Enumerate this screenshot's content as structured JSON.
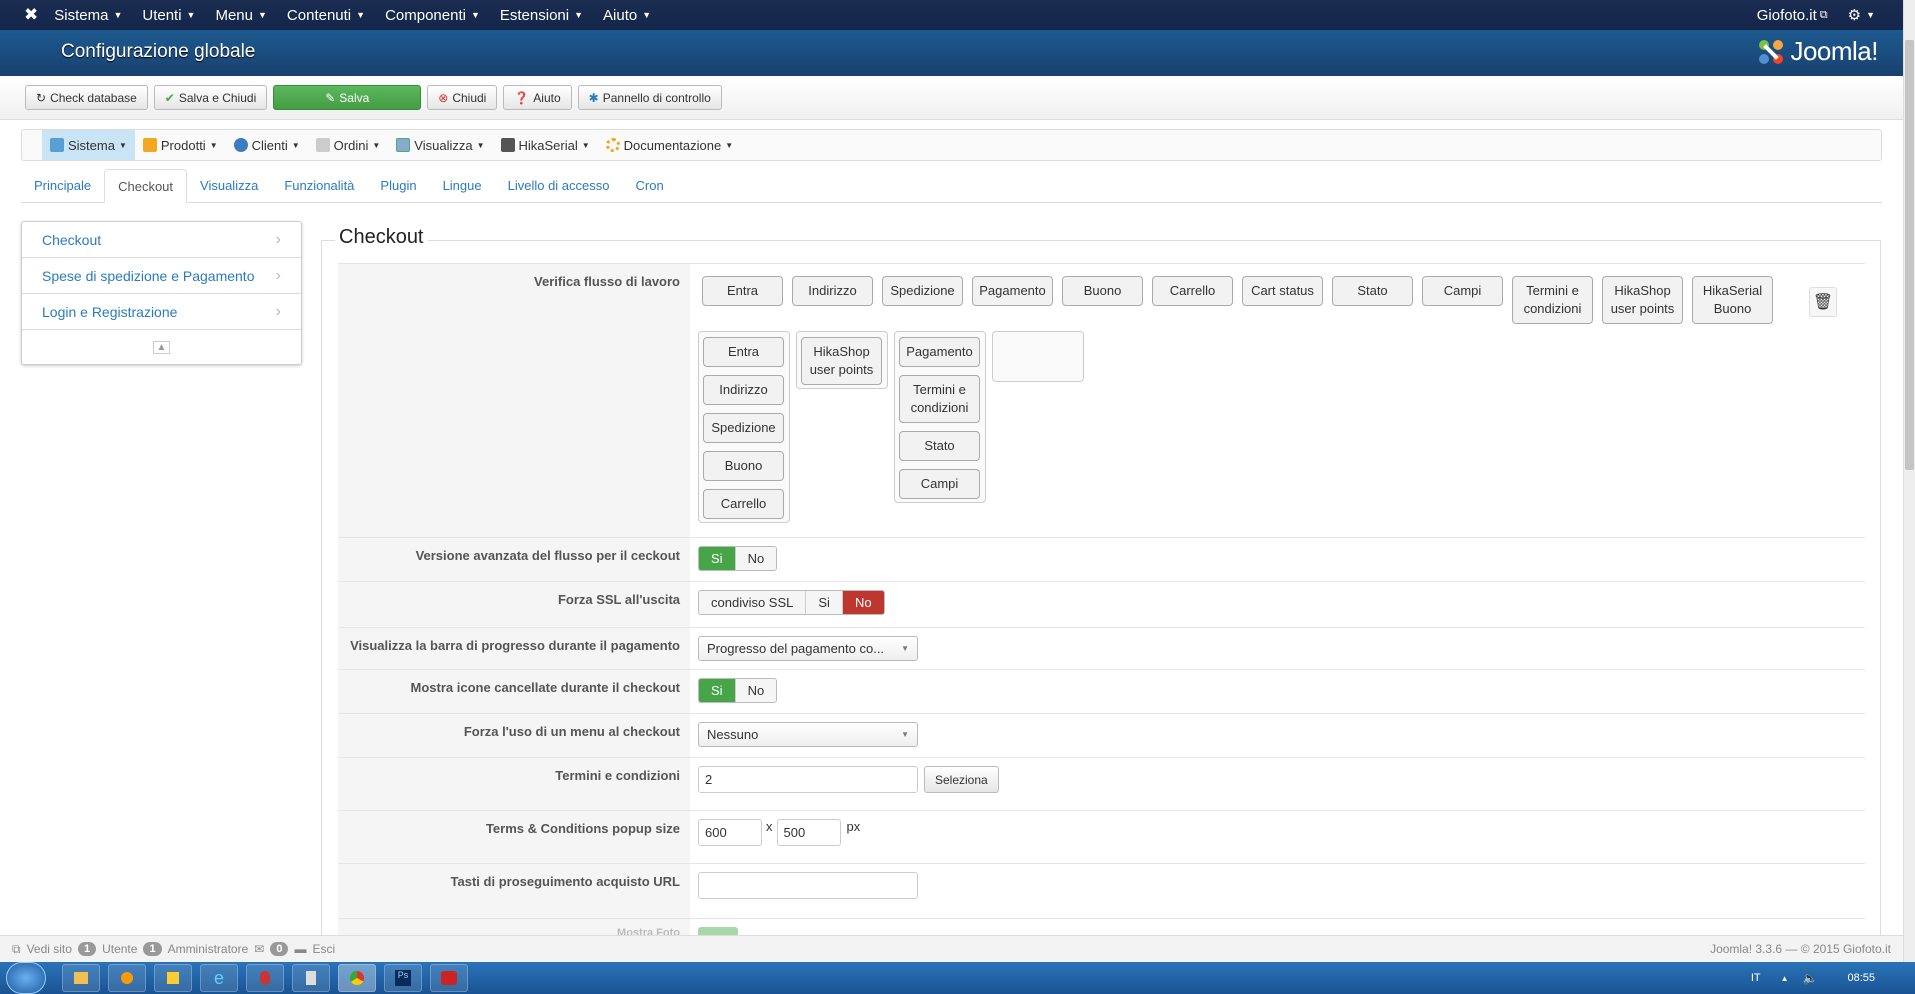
{
  "topnav": {
    "menus": [
      "Sistema",
      "Utenti",
      "Menu",
      "Contenuti",
      "Componenti",
      "Estensioni",
      "Aiuto"
    ],
    "site_link": "Giofoto.it"
  },
  "header": {
    "title": "Configurazione globale",
    "logo": "Joomla!"
  },
  "toolbar": {
    "check_database": "Check database",
    "save_close": "Salva e Chiudi",
    "save": "Salva",
    "close": "Chiudi",
    "help": "Aiuto",
    "control_panel": "Pannello di controllo"
  },
  "hikamenu": [
    "Sistema",
    "Prodotti",
    "Clienti",
    "Ordini",
    "Visualizza",
    "HikaSerial",
    "Documentazione"
  ],
  "tabs": [
    "Principale",
    "Checkout",
    "Visualizza",
    "Funzionalità",
    "Plugin",
    "Lingue",
    "Livello di accesso",
    "Cron"
  ],
  "sidebar": [
    "Checkout",
    "Spese di spedizione e Pagamento",
    "Login e Registrazione"
  ],
  "section": {
    "legend": "Checkout"
  },
  "workflow": {
    "label": "Verifica flusso di lavoro",
    "available": [
      "Entra",
      "Indirizzo",
      "Spedizione",
      "Pagamento",
      "Buono",
      "Carrello",
      "Cart status",
      "Stato",
      "Campi",
      "Termini e condizioni",
      "HikaShop user points",
      "HikaSerial Buono"
    ],
    "groups": [
      [
        "Entra",
        "Indirizzo",
        "Spedizione",
        "Buono",
        "Carrello"
      ],
      [
        "HikaShop user points"
      ],
      [
        "Pagamento",
        "Termini e condizioni",
        "Stato",
        "Campi"
      ],
      []
    ]
  },
  "fields": {
    "advanced": {
      "label": "Versione avanzata del flusso per il ceckout",
      "yes": "Si",
      "no": "No",
      "value": "Si"
    },
    "ssl": {
      "label": "Forza SSL all'uscita",
      "shared": "condiviso SSL",
      "yes": "Si",
      "no": "No",
      "value": "No"
    },
    "progress": {
      "label": "Visualizza la barra di progresso durante il pagamento",
      "value": "Progresso del pagamento co..."
    },
    "deleted_icons": {
      "label": "Mostra icone cancellate durante il checkout",
      "yes": "Si",
      "no": "No",
      "value": "Si"
    },
    "force_menu": {
      "label": "Forza l'uso di un menu al checkout",
      "value": "Nessuno"
    },
    "terms": {
      "label": "Termini e condizioni",
      "value": "2",
      "button": "Seleziona"
    },
    "popup": {
      "label": "Terms & Conditions popup size",
      "width": "600",
      "sep": "x",
      "height": "500",
      "unit": "px"
    },
    "continue_url": {
      "label": "Tasti di proseguimento acquisto URL",
      "value": ""
    },
    "next": {
      "label": "Mostra Foto"
    }
  },
  "status": {
    "view_site": "Vedi sito",
    "users_count": "1",
    "users": "Utente",
    "admins_count": "1",
    "admins": "Amministratore",
    "messages": "0",
    "logout": "Esci",
    "version": "Joomla! 3.3.6 — © 2015 Giofoto.it"
  },
  "taskbar": {
    "lang": "IT",
    "time": "08:55"
  }
}
